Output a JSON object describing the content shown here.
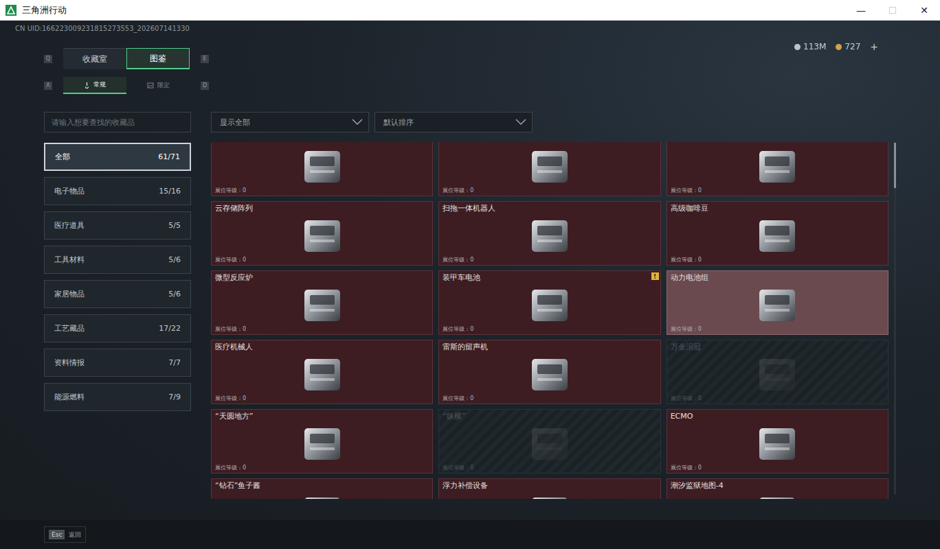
{
  "window": {
    "title": "三角洲行动",
    "controls": [
      {
        "label": "—",
        "disabled": false
      },
      {
        "label": "☐",
        "disabled": true
      },
      {
        "label": "✕",
        "disabled": false
      }
    ]
  },
  "uid": "CN UID:166223009231815273553_202607141330",
  "currencies": [
    {
      "amount": "113M",
      "color": "#bfc3c6"
    },
    {
      "amount": "727",
      "color": "#d4a24a"
    }
  ],
  "add_button": "+",
  "main_tabs": {
    "prev_key": "Q",
    "next_key": "E",
    "tabs": [
      {
        "label": "收藏室",
        "selected": false
      },
      {
        "label": "图鉴",
        "selected": true
      }
    ]
  },
  "sub_tabs": {
    "prev_key": "A",
    "next_key": "D",
    "tabs": [
      {
        "label": "常规",
        "selected": true
      },
      {
        "label": "限定",
        "selected": false
      }
    ]
  },
  "search": {
    "placeholder": "请输入想要查找的收藏品"
  },
  "categories": [
    {
      "label": "全部",
      "count": "61/71",
      "selected": true
    },
    {
      "label": "电子物品",
      "count": "15/16",
      "selected": false
    },
    {
      "label": "医疗道具",
      "count": "5/5",
      "selected": false
    },
    {
      "label": "工具材料",
      "count": "5/6",
      "selected": false
    },
    {
      "label": "家居物品",
      "count": "5/6",
      "selected": false
    },
    {
      "label": "工艺藏品",
      "count": "17/22",
      "selected": false
    },
    {
      "label": "资料情报",
      "count": "7/7",
      "selected": false
    },
    {
      "label": "能源燃料",
      "count": "7/9",
      "selected": false
    }
  ],
  "filters": [
    {
      "label": "显示全部"
    },
    {
      "label": "默认排序"
    }
  ],
  "cards": [
    {
      "collected": true,
      "highlighted": false,
      "level_text": "展位等级：0"
    },
    {
      "collected": true,
      "highlighted": false,
      "level_text": "展位等级：0"
    },
    {
      "collected": true,
      "highlighted": false,
      "level_text": "展位等级：0"
    },
    {
      "name": "云存储阵列",
      "collected": true,
      "highlighted": false,
      "level_text": "展位等级：0"
    },
    {
      "name": "扫拖一体机器人",
      "collected": true,
      "highlighted": false,
      "level_text": "展位等级：0"
    },
    {
      "name": "高级咖啡豆",
      "collected": true,
      "highlighted": false,
      "level_text": "展位等级：0"
    },
    {
      "name": "微型反应炉",
      "collected": true,
      "highlighted": false,
      "level_text": "展位等级：0"
    },
    {
      "name": "装甲车电池",
      "collected": true,
      "highlighted": false,
      "badge": "!",
      "level_text": "展位等级：0"
    },
    {
      "name": "动力电池组",
      "collected": true,
      "highlighted": true,
      "level_text": "展位等级：0"
    },
    {
      "name": "医疗机械人",
      "collected": true,
      "highlighted": false,
      "level_text": "展位等级：0"
    },
    {
      "name": "雷斯的留声机",
      "collected": true,
      "highlighted": false,
      "level_text": "展位等级：0"
    },
    {
      "name": "万金泪冠",
      "collected": false,
      "highlighted": false,
      "level_text": "展位等级：0"
    },
    {
      "name": "“天圆地方”",
      "collected": true,
      "highlighted": false,
      "level_text": "展位等级：0"
    },
    {
      "name": "“纵横”",
      "collected": false,
      "highlighted": false,
      "level_text": "展位等级：0"
    },
    {
      "name": "ECMO",
      "collected": true,
      "highlighted": false,
      "level_text": "展位等级：0"
    },
    {
      "name": "“钻石”鱼子酱",
      "collected": true,
      "highlighted": false
    },
    {
      "name": "浮力补偿设备",
      "collected": true,
      "highlighted": false
    },
    {
      "name": "潮汐监狱地图-4",
      "collected": true,
      "highlighted": false
    }
  ],
  "scrollbar": {
    "position": 0.22,
    "size": 0.13
  },
  "footer": {
    "key": "Esc",
    "label": "返回"
  }
}
